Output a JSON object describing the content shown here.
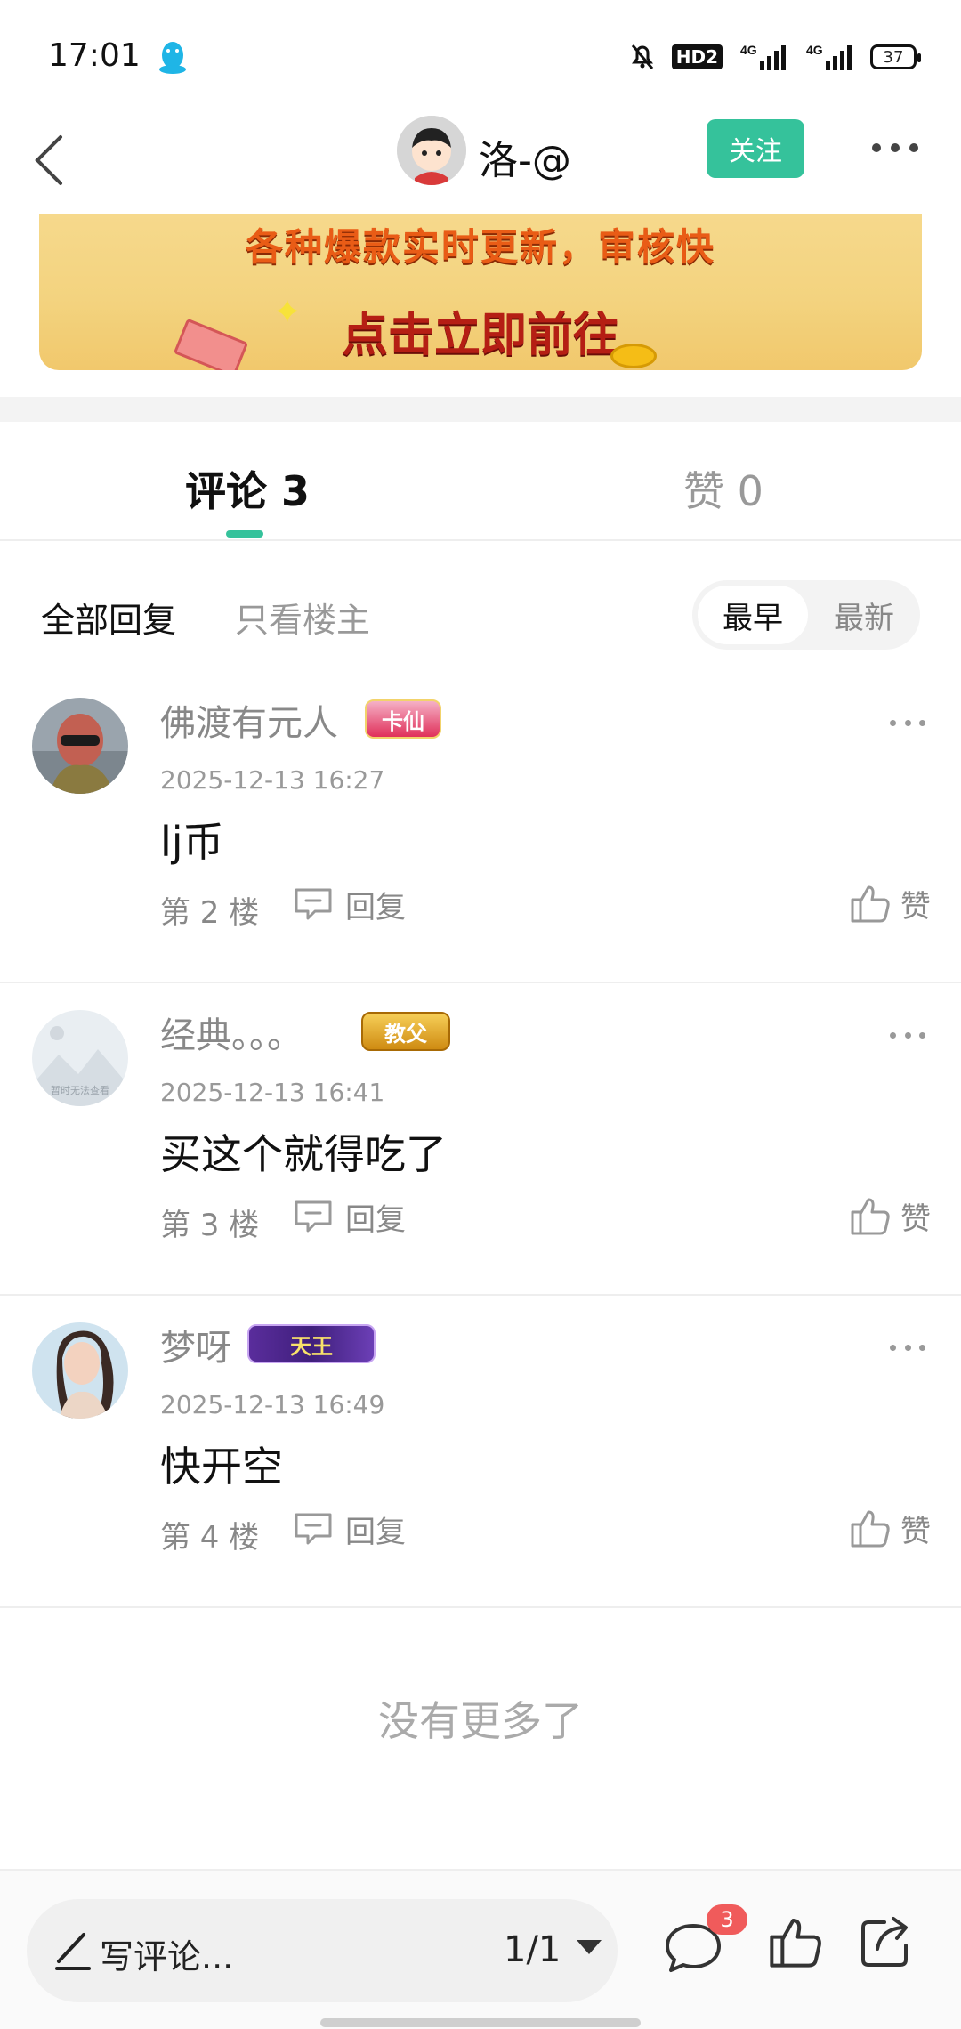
{
  "status_bar": {
    "time": "17:01",
    "battery": "37",
    "hd_label": "HD2",
    "net1": "4G",
    "net2": "4G"
  },
  "header": {
    "username": "洛-@",
    "follow_label": "关注"
  },
  "banner": {
    "line1": "各种爆款实时更新，审核快",
    "line2": "点击立即前往"
  },
  "tabs": [
    {
      "label": "评论 3"
    },
    {
      "label": "赞 0"
    }
  ],
  "filters": {
    "all": "全部回复",
    "op_only": "只看楼主",
    "sort_earliest": "最早",
    "sort_newest": "最新"
  },
  "comments": [
    {
      "name": "佛渡有元人",
      "badge": "卡仙",
      "time": "2025-12-13 16:27",
      "content": "lj币",
      "floor": "第 2 楼",
      "reply_label": "回复",
      "like_label": "赞"
    },
    {
      "name": "经典。。。",
      "badge": "教父",
      "time": "2025-12-13 16:41",
      "content": "买这个就得吃了",
      "floor": "第 3 楼",
      "reply_label": "回复",
      "like_label": "赞",
      "avatar_placeholder": "暂时无法查看"
    },
    {
      "name": "梦呀",
      "badge": "天王",
      "time": "2025-12-13 16:49",
      "content": "快开空",
      "floor": "第 4 楼",
      "reply_label": "回复",
      "like_label": "赞"
    }
  ],
  "no_more": "没有更多了",
  "bottom_bar": {
    "write_label": "写评论...",
    "page_indicator": "1/1",
    "comment_count": "3"
  },
  "colors": {
    "accent": "#35c29b",
    "badge_red": "#f05b5b"
  }
}
